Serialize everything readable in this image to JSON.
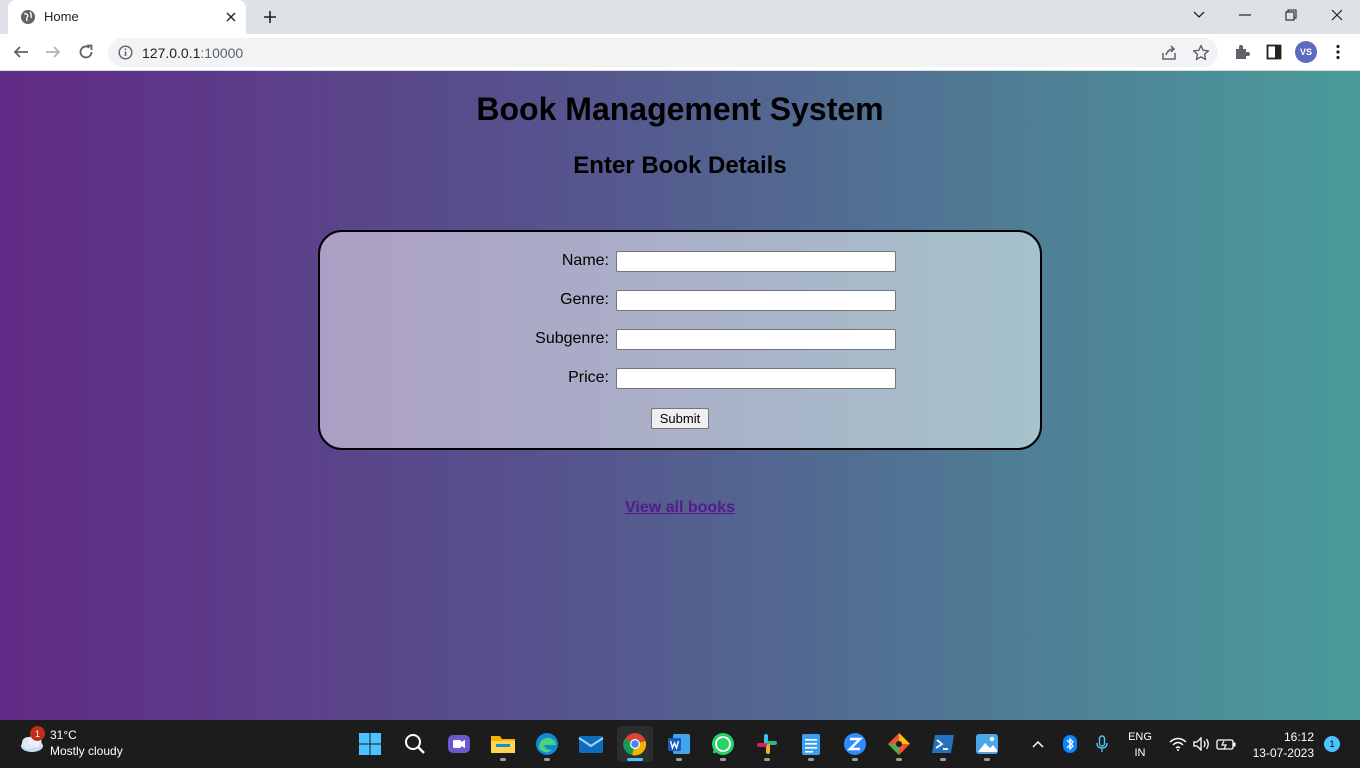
{
  "browser": {
    "tab_title": "Home",
    "url_host": "127.0.0.1",
    "url_rest": ":10000",
    "profile_initials": "VS"
  },
  "page": {
    "title": "Book Management System",
    "subtitle": "Enter Book Details",
    "form": {
      "fields": [
        {
          "label": "Name:",
          "value": ""
        },
        {
          "label": "Genre:",
          "value": ""
        },
        {
          "label": "Subgenre:",
          "value": ""
        },
        {
          "label": "Price:",
          "value": ""
        }
      ],
      "submit_label": "Submit"
    },
    "view_all_link": "View all books",
    "colors": {
      "gradient_left": "#612a86",
      "gradient_right": "#4a9c9b",
      "link": "#551a8b"
    }
  },
  "taskbar": {
    "weather": {
      "badge": "1",
      "temp": "31°C",
      "desc": "Mostly cloudy"
    },
    "apps": [
      "start-icon",
      "search-icon",
      "meet-icon",
      "file-explorer-icon",
      "edge-icon",
      "mail-icon",
      "chrome-icon",
      "word-icon",
      "whatsapp-icon",
      "slack-icon",
      "notepad-icon",
      "zoom-icon",
      "git-icon",
      "powershell-icon",
      "photos-icon"
    ],
    "language": {
      "line1": "ENG",
      "line2": "IN"
    },
    "clock": {
      "time": "16:12",
      "date": "13-07-2023"
    },
    "notification_count": "1"
  }
}
